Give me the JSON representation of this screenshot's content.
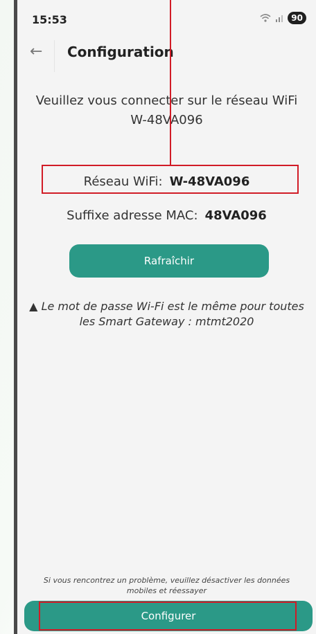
{
  "status_bar": {
    "time": "15:53",
    "wifi_icon": "wifi-icon",
    "signal_icon": "signal-icon",
    "battery": "90"
  },
  "app_bar": {
    "back_icon": "arrow-left-icon",
    "title": "Configuration"
  },
  "instruction": {
    "line1": "Veuillez vous connecter sur le réseau WiFi",
    "line2": "W-48VA096"
  },
  "network": {
    "label": "Réseau WiFi:",
    "value": "W-48VA096"
  },
  "mac": {
    "label": "Suffixe adresse MAC:",
    "value": "48VA096"
  },
  "refresh_button": "Rafraîchir",
  "warning": {
    "icon": "warning-triangle-icon",
    "line1": "Le mot de passe Wi-Fi est le même pour toutes",
    "line2": "les Smart Gateway : mtmt2020"
  },
  "help_note": {
    "line1": "Si vous rencontrez un problème, veuillez désactiver les données",
    "line2": "mobiles et réessayer"
  },
  "configure_button": "Configurer",
  "colors": {
    "accent": "#2b9987",
    "highlight": "#d11b26",
    "background": "#f4f4f4"
  }
}
